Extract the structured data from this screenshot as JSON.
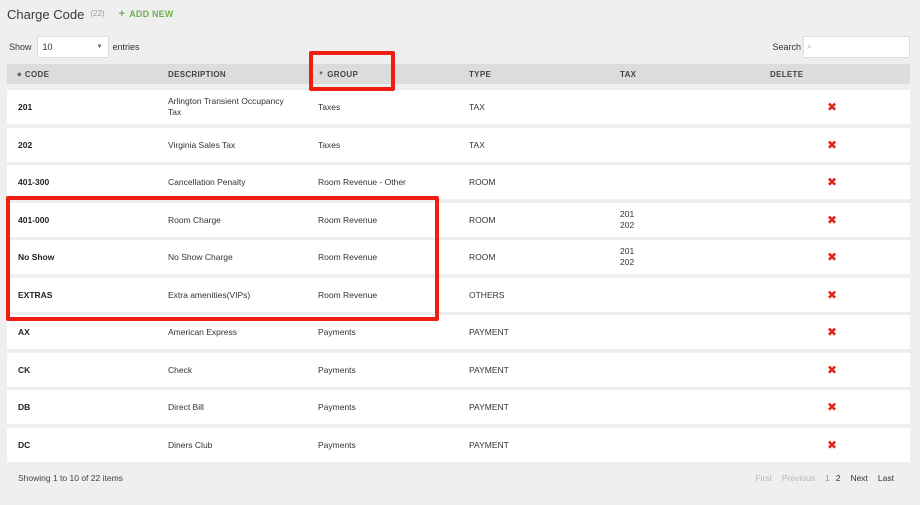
{
  "header": {
    "title": "Charge Code",
    "count": "(22)",
    "add_new": "ADD NEW"
  },
  "controls": {
    "show_label": "Show",
    "page_size": "10",
    "entries_label": "entries",
    "search_label": "Search",
    "search_placeholder": ""
  },
  "columns": {
    "code": "CODE",
    "description": "DESCRIPTION",
    "group": "GROUP",
    "type": "TYPE",
    "tax": "TAX",
    "delete": "DELETE"
  },
  "rows": [
    {
      "code": "201",
      "description_1": "Arlington Transient Occupancy",
      "description_2": "Tax",
      "group": "Taxes",
      "type": "TAX",
      "tax_1": "",
      "tax_2": ""
    },
    {
      "code": "202",
      "description_1": "Virginia Sales Tax",
      "description_2": "",
      "group": "Taxes",
      "type": "TAX",
      "tax_1": "",
      "tax_2": ""
    },
    {
      "code": "401-300",
      "description_1": "Cancellation Penalty",
      "description_2": "",
      "group": "Room Revenue - Other",
      "type": "ROOM",
      "tax_1": "",
      "tax_2": ""
    },
    {
      "code": "401-000",
      "description_1": "Room Charge",
      "description_2": "",
      "group": "Room Revenue",
      "type": "ROOM",
      "tax_1": "201",
      "tax_2": "202"
    },
    {
      "code": "No Show",
      "description_1": "No Show Charge",
      "description_2": "",
      "group": "Room Revenue",
      "type": "ROOM",
      "tax_1": "201",
      "tax_2": "202"
    },
    {
      "code": "EXTRAS",
      "description_1": "Extra amenities(VIPs)",
      "description_2": "",
      "group": "Room Revenue",
      "type": "OTHERS",
      "tax_1": "",
      "tax_2": ""
    },
    {
      "code": "AX",
      "description_1": "American Express",
      "description_2": "",
      "group": "Payments",
      "type": "PAYMENT",
      "tax_1": "",
      "tax_2": ""
    },
    {
      "code": "CK",
      "description_1": "Check",
      "description_2": "",
      "group": "Payments",
      "type": "PAYMENT",
      "tax_1": "",
      "tax_2": ""
    },
    {
      "code": "DB",
      "description_1": "Direct Bill",
      "description_2": "",
      "group": "Payments",
      "type": "PAYMENT",
      "tax_1": "",
      "tax_2": ""
    },
    {
      "code": "DC",
      "description_1": "Diners Club",
      "description_2": "",
      "group": "Payments",
      "type": "PAYMENT",
      "tax_1": "",
      "tax_2": ""
    }
  ],
  "delete_glyph": "✖",
  "footer": {
    "summary": "Showing 1 to 10 of 22 items"
  },
  "pagination": {
    "first": "First",
    "previous": "Previous",
    "page1": "1",
    "page2": "2",
    "next": "Next",
    "last": "Last"
  },
  "colors": {
    "accent_green": "#6cb04b",
    "delete_red": "#e0281c",
    "highlight_red": "#f01e12"
  }
}
